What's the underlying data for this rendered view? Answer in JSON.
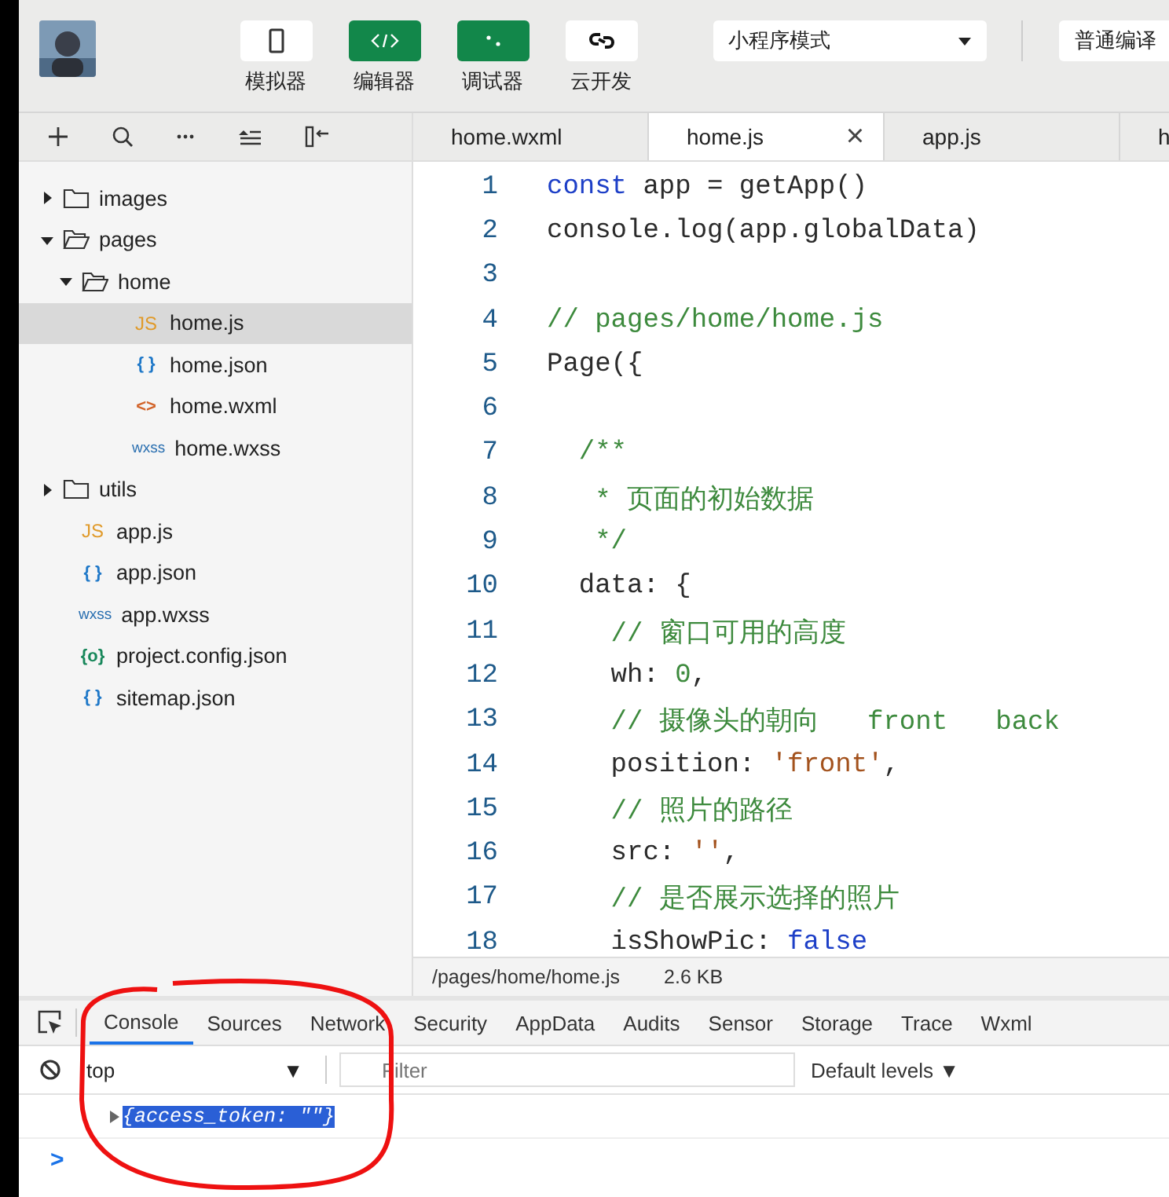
{
  "toolbar": {
    "buttons": [
      {
        "label": "模拟器",
        "kind": "phone",
        "on": false
      },
      {
        "label": "编辑器",
        "kind": "code",
        "on": true
      },
      {
        "label": "调试器",
        "kind": "debug",
        "on": true
      },
      {
        "label": "云开发",
        "kind": "cloud",
        "on": false
      }
    ],
    "mode_select": {
      "value": "小程序模式"
    },
    "compile_button": {
      "label": "普通编译"
    }
  },
  "editor_tabs": [
    {
      "label": "home.wxml",
      "selected": false,
      "closable": false
    },
    {
      "label": "home.js",
      "selected": true,
      "closable": true
    },
    {
      "label": "app.js",
      "selected": false,
      "closable": false
    },
    {
      "label": "h",
      "selected": false,
      "closable": false
    }
  ],
  "close_glyph": "×",
  "file_tree": [
    {
      "name": "images",
      "kind": "folder",
      "expanded": false,
      "selected": false
    },
    {
      "name": "pages",
      "kind": "folder",
      "expanded": true,
      "selected": false,
      "children": [
        {
          "name": "home",
          "kind": "folder",
          "expanded": true,
          "selected": false,
          "children": [
            {
              "name": "home.js",
              "kind": "js",
              "icon": "JS",
              "selected": true
            },
            {
              "name": "home.json",
              "kind": "json",
              "icon": "{ }",
              "selected": false
            },
            {
              "name": "home.wxml",
              "kind": "wxml",
              "icon": "<>",
              "selected": false
            },
            {
              "name": "home.wxss",
              "kind": "wxss",
              "icon": "wxss",
              "selected": false
            }
          ]
        }
      ]
    },
    {
      "name": "utils",
      "kind": "folder",
      "expanded": false,
      "selected": false
    },
    {
      "name": "app.js",
      "kind": "js",
      "icon": "JS",
      "selected": false
    },
    {
      "name": "app.json",
      "kind": "json",
      "icon": "{ }",
      "selected": false
    },
    {
      "name": "app.wxss",
      "kind": "wxss",
      "icon": "wxss",
      "selected": false
    },
    {
      "name": "project.config.json",
      "kind": "config",
      "icon": "{o}",
      "selected": false
    },
    {
      "name": "sitemap.json",
      "kind": "json",
      "icon": "{ }",
      "selected": false
    }
  ],
  "code_lines": [
    {
      "number": "1",
      "tokens": [
        {
          "text": "const",
          "kind": "keyword"
        },
        {
          "text": " app = getApp()",
          "kind": "plain"
        }
      ]
    },
    {
      "number": "2",
      "tokens": [
        {
          "text": "console.log(app.globalData)",
          "kind": "plain"
        }
      ]
    },
    {
      "number": "3"
    },
    {
      "number": "4",
      "tokens": [
        {
          "text": "// pages/home/home.js",
          "kind": "comment"
        }
      ]
    },
    {
      "number": "5",
      "tokens": [
        {
          "text": "Page({",
          "kind": "plain"
        }
      ]
    },
    {
      "number": "6"
    },
    {
      "number": "7",
      "tokens": [
        {
          "text": "  /**",
          "kind": "comment"
        }
      ]
    },
    {
      "number": "8",
      "tokens": [
        {
          "text": "   * 页面的初始数据",
          "kind": "comment"
        }
      ]
    },
    {
      "number": "9",
      "tokens": [
        {
          "text": "   */",
          "kind": "comment"
        }
      ]
    },
    {
      "number": "10",
      "tokens": [
        {
          "text": "  data: {",
          "kind": "plain"
        }
      ]
    },
    {
      "number": "11",
      "tokens": [
        {
          "text": "    // 窗口可用的高度",
          "kind": "comment"
        }
      ]
    },
    {
      "number": "12",
      "tokens": [
        {
          "text": "    wh: ",
          "kind": "plain"
        },
        {
          "text": "0",
          "kind": "number"
        },
        {
          "text": ",",
          "kind": "plain"
        }
      ]
    },
    {
      "number": "13",
      "tokens": [
        {
          "text": "    // 摄像头的朝向   front   back",
          "kind": "comment"
        }
      ]
    },
    {
      "number": "14",
      "tokens": [
        {
          "text": "    position: ",
          "kind": "plain"
        },
        {
          "text": "'front'",
          "kind": "string"
        },
        {
          "text": ",",
          "kind": "plain"
        }
      ]
    },
    {
      "number": "15",
      "tokens": [
        {
          "text": "    // 照片的路径",
          "kind": "comment"
        }
      ]
    },
    {
      "number": "16",
      "tokens": [
        {
          "text": "    src: ",
          "kind": "plain"
        },
        {
          "text": "''",
          "kind": "string"
        },
        {
          "text": ",",
          "kind": "plain"
        }
      ]
    },
    {
      "number": "17",
      "tokens": [
        {
          "text": "    // 是否展示选择的照片",
          "kind": "comment"
        }
      ]
    },
    {
      "number": "18",
      "tokens": [
        {
          "text": "    isShowPic: ",
          "kind": "plain"
        },
        {
          "text": "false",
          "kind": "keyword"
        }
      ]
    }
  ],
  "status_bar": {
    "path": "/pages/home/home.js",
    "size": "2.6 KB"
  },
  "devtools": {
    "tabs": [
      {
        "label": "Console",
        "selected": true
      },
      {
        "label": "Sources",
        "selected": false
      },
      {
        "label": "Network",
        "selected": false
      },
      {
        "label": "Security",
        "selected": false
      },
      {
        "label": "AppData",
        "selected": false
      },
      {
        "label": "Audits",
        "selected": false
      },
      {
        "label": "Sensor",
        "selected": false
      },
      {
        "label": "Storage",
        "selected": false
      },
      {
        "label": "Trace",
        "selected": false
      },
      {
        "label": "Wxml",
        "selected": false
      }
    ],
    "context": "top",
    "filter_placeholder": "Filter",
    "levels": "Default levels",
    "dropdown_glyph": "▼",
    "output": [
      {
        "text": "{access_token: \"\"}",
        "selected": true
      }
    ],
    "prompt": ">"
  }
}
